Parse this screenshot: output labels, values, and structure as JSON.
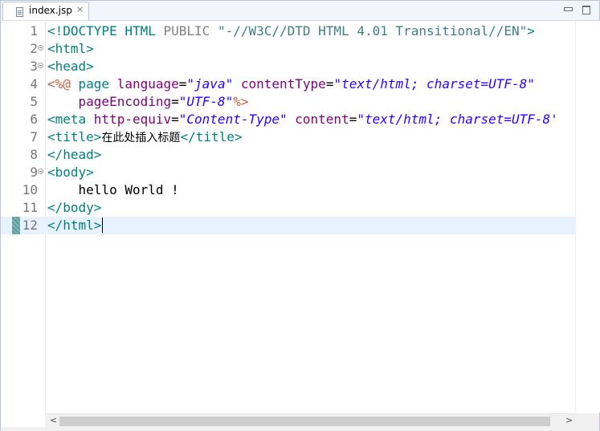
{
  "tab": {
    "file_name": "index.jsp",
    "close_glyph": "×",
    "file_icon": "jsp-file-icon"
  },
  "window_controls": {
    "minimize_icon": "minimize-icon",
    "maximize_icon": "maximize-icon"
  },
  "editor": {
    "current_line": 12,
    "lines": [
      {
        "number": "1",
        "fold": false,
        "tokens": [
          {
            "cls": "t-doctype",
            "text": "<!DOCTYPE "
          },
          {
            "cls": "t-doctype",
            "text": "HTML "
          },
          {
            "cls": "t-doctype-kw",
            "text": "PUBLIC "
          },
          {
            "cls": "t-str",
            "text": "\"-//W3C//DTD HTML 4.01 Transitional//EN\""
          },
          {
            "cls": "t-doctype",
            "text": ">"
          }
        ]
      },
      {
        "number": "2",
        "fold": true,
        "tokens": [
          {
            "cls": "t-tag",
            "text": "<html>"
          }
        ]
      },
      {
        "number": "3",
        "fold": true,
        "tokens": [
          {
            "cls": "t-tag",
            "text": "<head>"
          }
        ]
      },
      {
        "number": "4",
        "fold": false,
        "tokens": [
          {
            "cls": "t-jsp",
            "text": "<%@ "
          },
          {
            "cls": "t-tag",
            "text": "page "
          },
          {
            "cls": "t-attr",
            "text": "language"
          },
          {
            "cls": "t-text",
            "text": "="
          },
          {
            "cls": "t-val",
            "text": "\"java\""
          },
          {
            "cls": "t-text",
            "text": " "
          },
          {
            "cls": "t-attr",
            "text": "contentType"
          },
          {
            "cls": "t-text",
            "text": "="
          },
          {
            "cls": "t-val",
            "text": "\"text/html; charset=UTF-8\""
          }
        ]
      },
      {
        "number": "5",
        "fold": false,
        "tokens": [
          {
            "cls": "t-text",
            "text": "    "
          },
          {
            "cls": "t-attr",
            "text": "pageEncoding"
          },
          {
            "cls": "t-text",
            "text": "="
          },
          {
            "cls": "t-val",
            "text": "\"UTF-8\""
          },
          {
            "cls": "t-jsp",
            "text": "%>"
          }
        ]
      },
      {
        "number": "6",
        "fold": false,
        "tokens": [
          {
            "cls": "t-tag",
            "text": "<meta "
          },
          {
            "cls": "t-attr",
            "text": "http-equiv"
          },
          {
            "cls": "t-text",
            "text": "="
          },
          {
            "cls": "t-val",
            "text": "\"Content-Type\""
          },
          {
            "cls": "t-text",
            "text": " "
          },
          {
            "cls": "t-attr",
            "text": "content"
          },
          {
            "cls": "t-text",
            "text": "="
          },
          {
            "cls": "t-val",
            "text": "\"text/html; charset=UTF-8'"
          }
        ]
      },
      {
        "number": "7",
        "fold": false,
        "tokens": [
          {
            "cls": "t-tag",
            "text": "<title>"
          },
          {
            "cls": "t-text cjk",
            "text": "在此处插入标题"
          },
          {
            "cls": "t-tag",
            "text": "</title>"
          }
        ]
      },
      {
        "number": "8",
        "fold": false,
        "tokens": [
          {
            "cls": "t-tag",
            "text": "</head>"
          }
        ]
      },
      {
        "number": "9",
        "fold": true,
        "tokens": [
          {
            "cls": "t-tag",
            "text": "<body>"
          }
        ]
      },
      {
        "number": "10",
        "fold": false,
        "tokens": [
          {
            "cls": "t-text",
            "text": "    hello World !"
          }
        ]
      },
      {
        "number": "11",
        "fold": false,
        "tokens": [
          {
            "cls": "t-tag",
            "text": "</body>"
          }
        ]
      },
      {
        "number": "12",
        "fold": false,
        "tokens": [
          {
            "cls": "t-tag",
            "text": "</html>"
          }
        ]
      }
    ]
  },
  "scrollbar": {
    "left_arrow": "<",
    "right_arrow": ">"
  }
}
